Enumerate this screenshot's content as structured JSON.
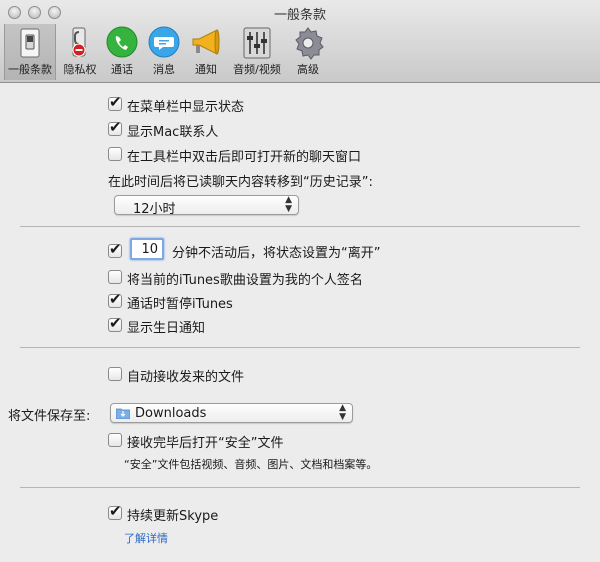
{
  "window": {
    "title": "一般条款"
  },
  "toolbar": {
    "items": [
      {
        "label": "一般条款",
        "icon": "switch-icon",
        "selected": true
      },
      {
        "label": "隐私权",
        "icon": "privacy-icon"
      },
      {
        "label": "通话",
        "icon": "phone-icon"
      },
      {
        "label": "消息",
        "icon": "message-icon"
      },
      {
        "label": "通知",
        "icon": "megaphone-icon"
      },
      {
        "label": "音频/视频",
        "icon": "equalizer-icon"
      },
      {
        "label": "高级",
        "icon": "gear-icon"
      }
    ]
  },
  "section1": {
    "show_status_menubar": {
      "label": "在菜单栏中显示状态",
      "checked": true
    },
    "show_mac_contacts": {
      "label": "显示Mac联系人",
      "checked": true
    },
    "double_click_toolbar": {
      "label": "在工具栏中双击后即可打开新的聊天窗口",
      "checked": false
    },
    "history_label": "在此时间后将已读聊天内容转移到“历史记录”:",
    "history_value": "12小时"
  },
  "section2": {
    "away": {
      "checked": true,
      "minutes": "10",
      "label": "分钟不活动后，将状态设置为“离开”"
    },
    "itunes_status": {
      "label": "将当前的iTunes歌曲设置为我的个人签名",
      "checked": false
    },
    "pause_itunes": {
      "label": "通话时暂停iTunes",
      "checked": true
    },
    "birthday": {
      "label": "显示生日通知",
      "checked": true
    }
  },
  "section3": {
    "auto_receive": {
      "label": "自动接收发来的文件",
      "checked": false
    },
    "save_to_label": "将文件保存至:",
    "save_to_value": "Downloads",
    "open_safe": {
      "label": "接收完毕后打开“安全”文件",
      "checked": false
    },
    "safe_note": "“安全”文件包括视频、音频、图片、文档和档案等。"
  },
  "section4": {
    "keep_updated": {
      "label": "持续更新Skype",
      "checked": true
    },
    "learn_more": "了解详情"
  },
  "colors": {
    "accent": "#2a68c8",
    "background": "#ececec"
  }
}
